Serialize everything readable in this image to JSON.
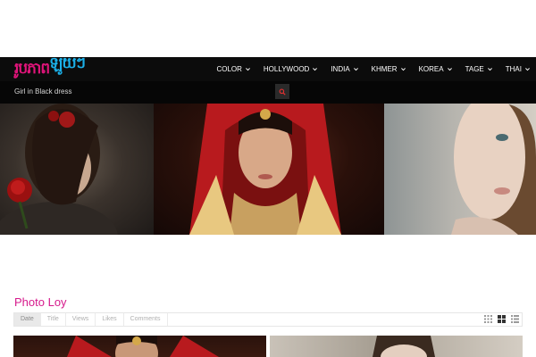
{
  "site": {
    "logo_part1": "រូបភាព",
    "logo_part2": "ឡូយៗ"
  },
  "nav": {
    "items": [
      {
        "label": "COLOR"
      },
      {
        "label": "HOLLYWOOD"
      },
      {
        "label": "INDIA"
      },
      {
        "label": "KHMER"
      },
      {
        "label": "KOREA"
      },
      {
        "label": "TAGE"
      },
      {
        "label": "THAI"
      }
    ]
  },
  "search": {
    "value": "Girl in Black dress",
    "button_icon": "search-icon"
  },
  "section": {
    "title": "Photo Loy",
    "sort_tabs": [
      {
        "label": "Date",
        "active": true
      },
      {
        "label": "Title",
        "active": false
      },
      {
        "label": "Views",
        "active": false
      },
      {
        "label": "Likes",
        "active": false
      },
      {
        "label": "Comments",
        "active": false
      }
    ],
    "view_modes": [
      "small-grid-icon",
      "large-grid-icon",
      "list-icon"
    ]
  },
  "colors": {
    "accent_pink": "#d61a8c",
    "logo_blue": "#1bb0e8",
    "search_button_icon": "#e03030",
    "nav_bg": "#0c0c0c"
  }
}
